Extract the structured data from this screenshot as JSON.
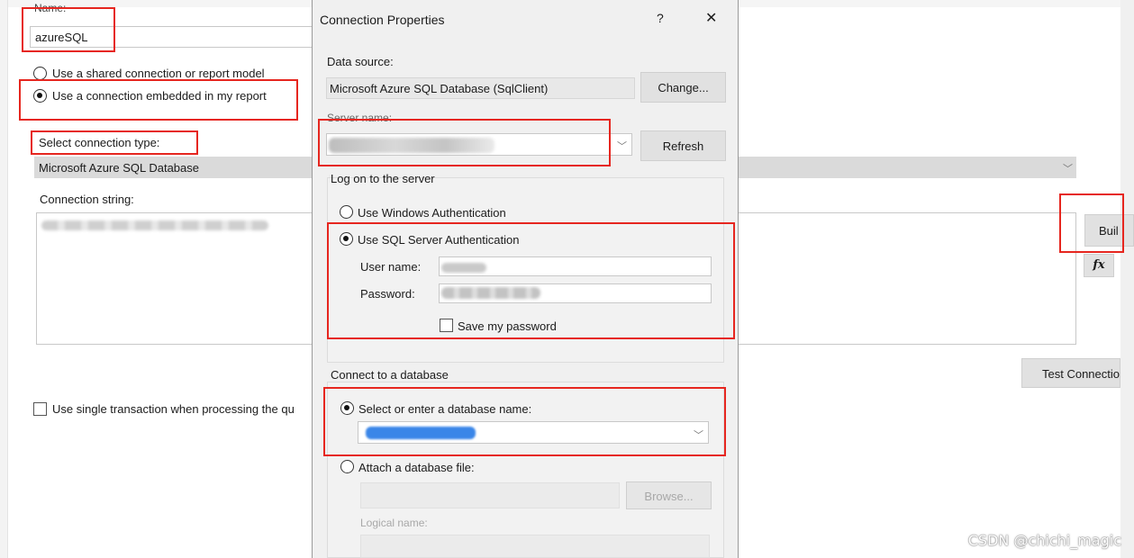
{
  "background_dialog": {
    "name_label": "Name:",
    "name_value": "azureSQL",
    "radio_shared": "Use a shared connection or report model",
    "radio_embedded": "Use a connection embedded in my report",
    "select_type_label": "Select connection type:",
    "connection_type_value": "Microsoft Azure SQL Database",
    "connection_string_label": "Connection string:",
    "build_button": "Buil",
    "fx_button": "fx",
    "test_connection_button": "Test Connectio",
    "single_transaction_label": "Use single transaction when processing the qu"
  },
  "modal": {
    "title": "Connection Properties",
    "help": "?",
    "close": "✕",
    "data_source_label": "Data source:",
    "data_source_value": "Microsoft Azure SQL Database (SqlClient)",
    "change_button": "Change...",
    "server_name_label": "Server name:",
    "refresh_button": "Refresh",
    "logon_group": "Log on to the server",
    "windows_auth": "Use Windows Authentication",
    "sql_auth": "Use SQL Server Authentication",
    "user_name_label": "User name:",
    "password_label": "Password:",
    "save_password": "Save my password",
    "connect_group": "Connect to a database",
    "select_db": "Select or enter a database name:",
    "attach_db": "Attach a database file:",
    "browse_button": "Browse...",
    "logical_name_label": "Logical name:"
  },
  "watermark": "CSDN @chichi_magic",
  "colors": {
    "highlight_red": "#e6261f",
    "selection_blue": "#3a86e8"
  }
}
